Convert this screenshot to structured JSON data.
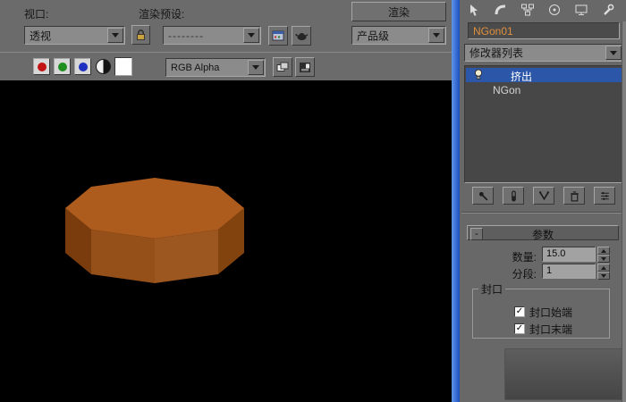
{
  "render_window": {
    "toolbar": {
      "viewport_label": "视口:",
      "viewport_value": "透视",
      "preset_label": "渲染预设:",
      "preset_value": "--------",
      "render_button_label": "渲染",
      "mode_value": "产品级"
    },
    "channel_bar": {
      "display_dropdown_value": "RGB Alpha"
    }
  },
  "viewport": {
    "object": "extruded octagon (NGon with Extrude modifier)",
    "colors": {
      "background": "#000000",
      "top_face": "#ae5c1e",
      "face_left": "#7a3c0d",
      "face_front_left": "#955019",
      "face_front_right": "#9c561f",
      "face_right": "#83430f"
    }
  },
  "command_panel": {
    "object_name": "NGon01",
    "modifier_list_label": "修改器列表",
    "modifier_stack": [
      {
        "label": "挤出",
        "selected": true
      },
      {
        "label": "NGon",
        "selected": false
      }
    ],
    "parameters": {
      "rollout_title": "参数",
      "collapse_glyph": "-",
      "amount_label": "数量:",
      "amount_value": "15.0",
      "segments_label": "分段:",
      "segments_value": "1",
      "cap_title": "封口",
      "cap_start_label": "封口始端",
      "cap_end_label": "封口末端",
      "check_glyph": "✓"
    }
  },
  "colors": {
    "selection_blue": "#2c57a8",
    "accent_strip_blue": "#2a5fd0",
    "object_name_text": "#df8f3c"
  }
}
